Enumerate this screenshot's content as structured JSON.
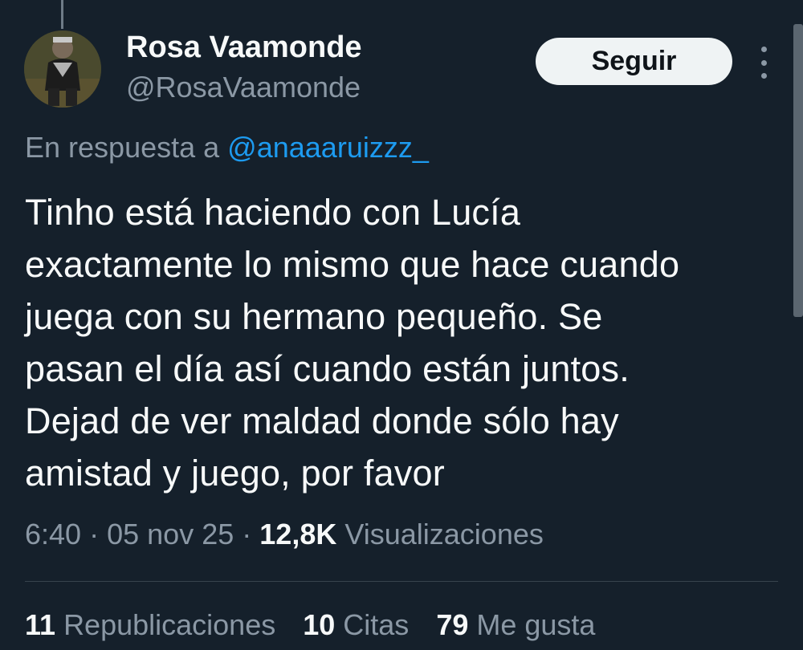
{
  "author": {
    "display_name": "Rosa Vaamonde",
    "handle": "@RosaVaamonde",
    "avatar_icon": "profile-photo-icon"
  },
  "follow_button": {
    "label": "Seguir"
  },
  "more_button": {
    "icon": "more-vertical-icon"
  },
  "reply_context": {
    "prefix": "En respuesta a",
    "mention": "@anaaaruizzz_"
  },
  "tweet": {
    "text_lines": [
      "Tinho está haciendo con Lucía",
      "exactamente lo mismo que hace cuando",
      "juega con su hermano pequeño. Se",
      "pasan el día así cuando están juntos.",
      "Dejad de ver maldad donde sólo hay",
      "amistad y juego, por favor"
    ]
  },
  "meta": {
    "time": "6:40",
    "separator": "·",
    "date": "05 nov 25",
    "views_count": "12,8K",
    "views_label": "Visualizaciones"
  },
  "stats": {
    "reposts_count": "11",
    "reposts_label": "Republicaciones",
    "quotes_count": "10",
    "quotes_label": "Citas",
    "likes_count": "79",
    "likes_label": "Me gusta"
  },
  "colors": {
    "background": "#15202b",
    "text_primary": "#f7f9f9",
    "text_secondary": "#8b98a5",
    "link": "#1d9bf0",
    "button_bg": "#eff3f4"
  }
}
